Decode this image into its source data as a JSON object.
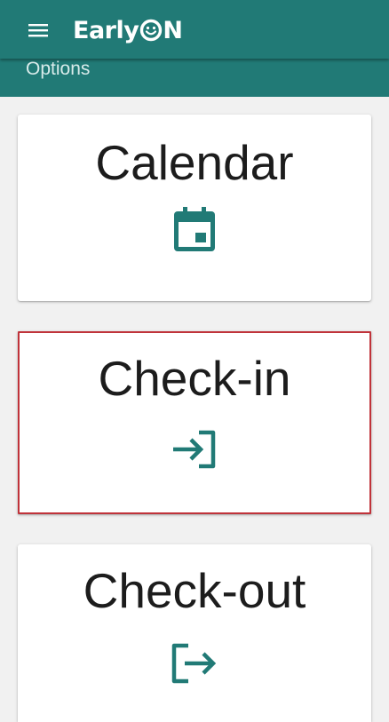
{
  "app": {
    "name": "EarlyON",
    "name_prefix": "Early",
    "name_suffix": "N",
    "menu_icon": "hamburger-menu-icon"
  },
  "section": {
    "title": "Options"
  },
  "options": [
    {
      "label": "Calendar",
      "icon": "calendar-icon",
      "selected": false
    },
    {
      "label": "Check-in",
      "icon": "login-icon",
      "selected": true
    },
    {
      "label": "Check-out",
      "icon": "logout-icon",
      "selected": false
    }
  ],
  "colors": {
    "primary": "#217a76",
    "icon": "#217a76",
    "selection_border": "#c0333a",
    "background": "#f1f1f1",
    "card": "#ffffff"
  }
}
